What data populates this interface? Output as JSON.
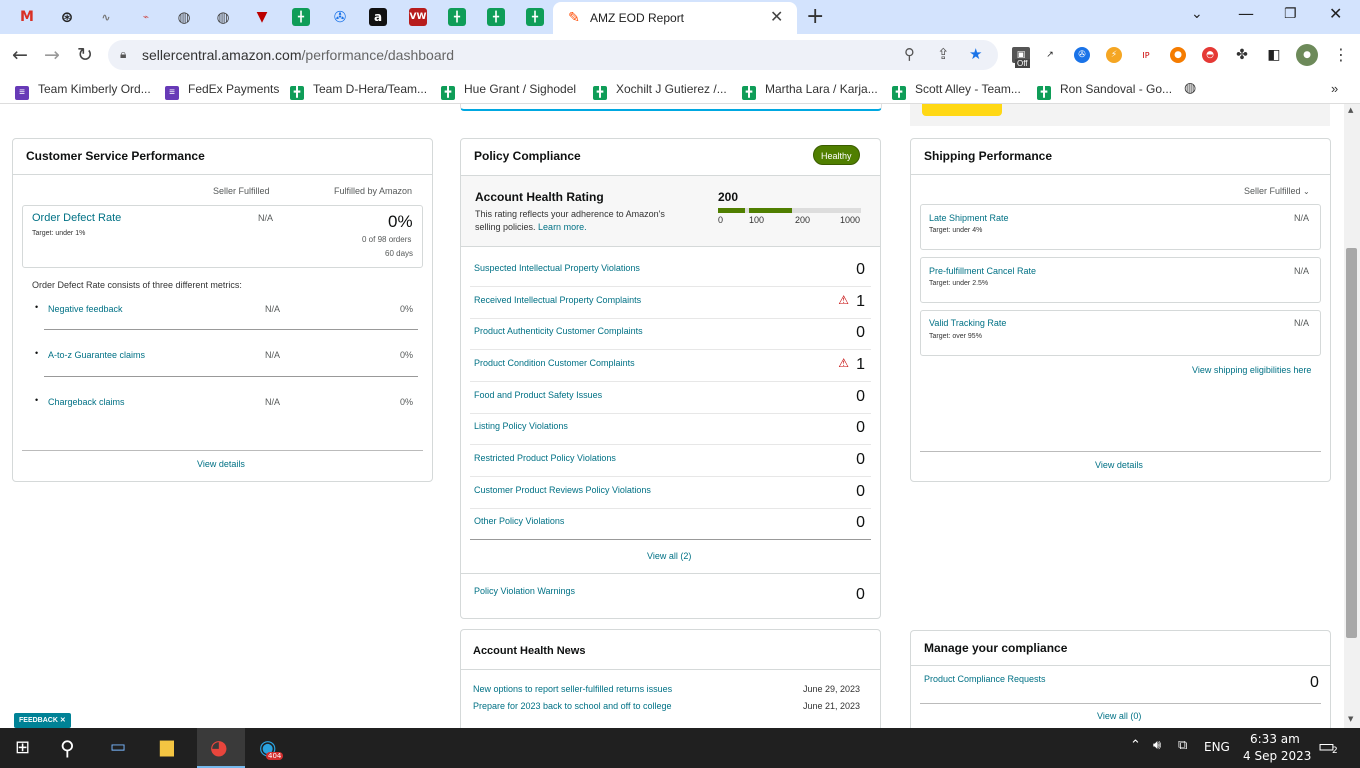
{
  "browser": {
    "active_tab_title": "AMZ EOD Report",
    "url_host": "sellercentral.amazon.com",
    "url_path": "/performance/dashboard",
    "ext_badge": "Off"
  },
  "bookmarks": [
    {
      "label": "Team Kimberly Ord...",
      "icon": "form-icon"
    },
    {
      "label": "FedEx Payments",
      "icon": "form-icon"
    },
    {
      "label": "Team D-Hera/Team...",
      "icon": "sheets-icon"
    },
    {
      "label": "Hue Grant / Sighodel",
      "icon": "sheets-icon"
    },
    {
      "label": "Xochilt J Gutierez /...",
      "icon": "sheets-icon"
    },
    {
      "label": "Martha Lara / Karja...",
      "icon": "sheets-icon"
    },
    {
      "label": "Scott Alley - Team...",
      "icon": "sheets-icon"
    },
    {
      "label": "Ron Sandoval - Go...",
      "icon": "sheets-icon"
    }
  ],
  "customer_service": {
    "title": "Customer Service Performance",
    "col_seller": "Seller Fulfilled",
    "col_fba": "Fulfilled by Amazon",
    "odr_label": "Order Defect Rate",
    "odr_target": "Target: under 1%",
    "odr_seller": "N/A",
    "odr_fba": "0%",
    "odr_orders": "0 of 98 orders",
    "odr_days": "60 days",
    "consists": "Order Defect Rate consists of three different metrics:",
    "metrics": [
      {
        "label": "Negative feedback",
        "seller": "N/A",
        "fba": "0%"
      },
      {
        "label": "A-to-z Guarantee claims",
        "seller": "N/A",
        "fba": "0%"
      },
      {
        "label": "Chargeback claims",
        "seller": "N/A",
        "fba": "0%"
      }
    ],
    "view_details": "View details"
  },
  "policy": {
    "title": "Policy Compliance",
    "status": "Healthy",
    "ahr_title": "Account Health Rating",
    "ahr_desc1": "This rating reflects your adherence to Amazon's",
    "ahr_desc2": "selling policies.",
    "learn_more": "Learn more.",
    "ahr_value": "200",
    "ahr_score": 200,
    "scale": [
      "0",
      "100",
      "200",
      "1000"
    ],
    "rows": [
      {
        "label": "Suspected Intellectual Property Violations",
        "value": "0",
        "warn": false
      },
      {
        "label": "Received Intellectual Property Complaints",
        "value": "1",
        "warn": true
      },
      {
        "label": "Product Authenticity Customer Complaints",
        "value": "0",
        "warn": false
      },
      {
        "label": "Product Condition Customer Complaints",
        "value": "1",
        "warn": true
      },
      {
        "label": "Food and Product Safety Issues",
        "value": "0",
        "warn": false
      },
      {
        "label": "Listing Policy Violations",
        "value": "0",
        "warn": false
      },
      {
        "label": "Restricted Product Policy Violations",
        "value": "0",
        "warn": false
      },
      {
        "label": "Customer Product Reviews Policy Violations",
        "value": "0",
        "warn": false
      },
      {
        "label": "Other Policy Violations",
        "value": "0",
        "warn": false
      }
    ],
    "view_all": "View all (2)",
    "warnings_label": "Policy Violation Warnings",
    "warnings_value": "0"
  },
  "shipping": {
    "title": "Shipping Performance",
    "filter": "Seller Fulfilled",
    "metrics": [
      {
        "label": "Late Shipment Rate",
        "target": "Target: under 4%",
        "value": "N/A"
      },
      {
        "label": "Pre-fulfillment Cancel Rate",
        "target": "Target: under 2.5%",
        "value": "N/A"
      },
      {
        "label": "Valid Tracking Rate",
        "target": "Target: over 95%",
        "value": "N/A"
      }
    ],
    "eligibilities": "View shipping eligibilities here",
    "view_details": "View details"
  },
  "news": {
    "title": "Account Health News",
    "items": [
      {
        "label": "New options to report seller-fulfilled returns issues",
        "date": "June 29, 2023"
      },
      {
        "label": "Prepare for 2023 back to school and off to college",
        "date": "June 21, 2023"
      }
    ]
  },
  "manage": {
    "title": "Manage your compliance",
    "row_label": "Product Compliance Requests",
    "row_value": "0",
    "view_all": "View all (0)"
  },
  "feedback": "FEEDBACK",
  "taskbar": {
    "time": "6:33 am",
    "date": "4 Sep 2023",
    "lang": "ENG",
    "notif_count": "2",
    "telegram_badge": "404"
  }
}
